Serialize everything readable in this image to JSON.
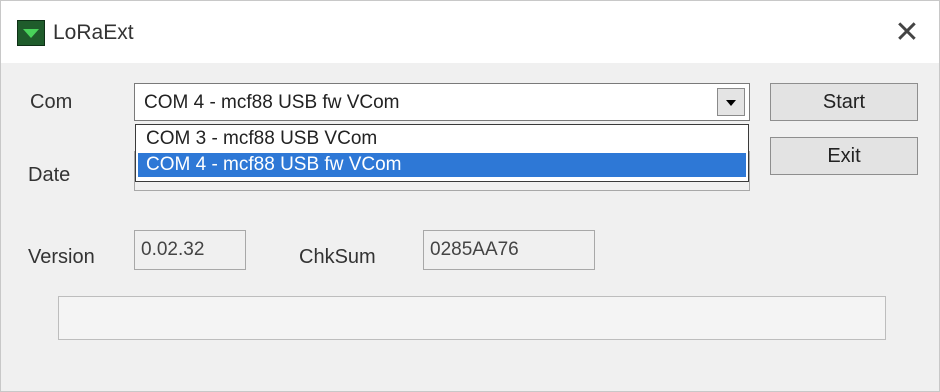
{
  "window": {
    "title": "LoRaExt"
  },
  "labels": {
    "com": "Com",
    "date": "Date",
    "version": "Version",
    "chksum": "ChkSum"
  },
  "com": {
    "selected": "COM  4 - mcf88 USB fw VCom",
    "options": [
      "COM  3 - mcf88 USB VCom",
      "COM  4 - mcf88 USB fw VCom"
    ],
    "highlighted_index": 1
  },
  "buttons": {
    "start": "Start",
    "exit": "Exit"
  },
  "fields": {
    "version": "0.02.32",
    "chksum": "0285AA76",
    "date": ""
  },
  "progress": {
    "value": 0
  },
  "colors": {
    "selection": "#2e78d6",
    "icon": "#1f5c2b"
  }
}
